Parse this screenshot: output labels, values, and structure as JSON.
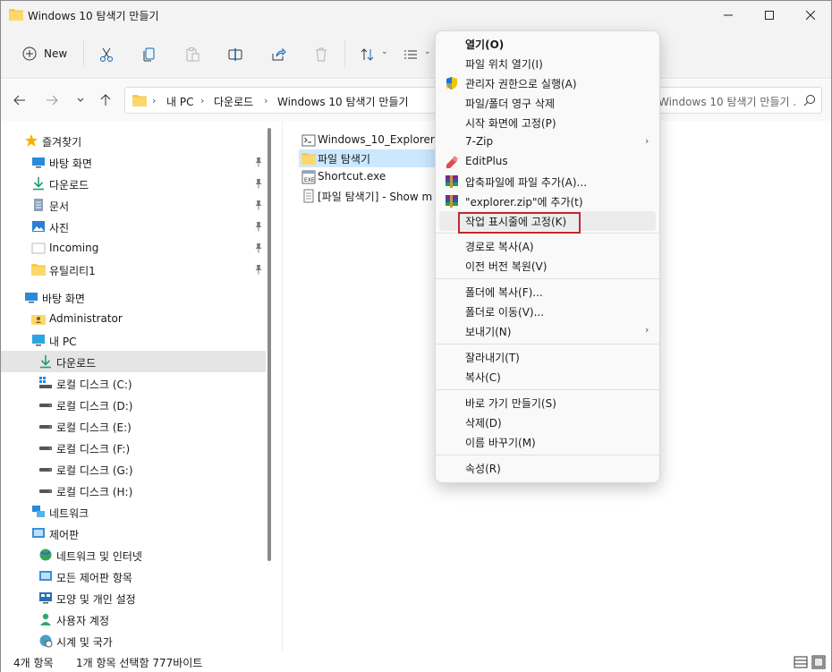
{
  "window": {
    "title": "Windows 10 탐색기 만들기"
  },
  "toolbar": {
    "new_label": "New"
  },
  "address": {
    "crumbs": [
      "내 PC",
      "다운로드",
      "Windows 10 탐색기 만들기"
    ],
    "search_placeholder": "Windows 10 탐색기 만들기 ..."
  },
  "nav": {
    "items": [
      {
        "label": "즐겨찾기",
        "icon": "star-icon"
      },
      {
        "label": "바탕 화면",
        "icon": "desktop-icon",
        "pinned": true
      },
      {
        "label": "다운로드",
        "icon": "download-icon",
        "pinned": true
      },
      {
        "label": "문서",
        "icon": "document-icon",
        "pinned": true
      },
      {
        "label": "사진",
        "icon": "pictures-icon",
        "pinned": true
      },
      {
        "label": "Incoming",
        "icon": "folder-white-icon",
        "pinned": true
      },
      {
        "label": "유틸리티1",
        "icon": "folder-icon",
        "pinned": true
      },
      {
        "label": "바탕 화면",
        "icon": "desktop-icon"
      },
      {
        "label": "Administrator",
        "icon": "user-folder-icon"
      },
      {
        "label": "내 PC",
        "icon": "pc-icon"
      },
      {
        "label": "다운로드",
        "icon": "download-icon",
        "selected": true
      },
      {
        "label": "로컬 디스크 (C:)",
        "icon": "system-drive-icon"
      },
      {
        "label": "로컬 디스크 (D:)",
        "icon": "drive-icon"
      },
      {
        "label": "로컬 디스크 (E:)",
        "icon": "drive-icon"
      },
      {
        "label": "로컬 디스크 (F:)",
        "icon": "drive-icon"
      },
      {
        "label": "로컬 디스크 (G:)",
        "icon": "drive-icon"
      },
      {
        "label": "로컬 디스크 (H:)",
        "icon": "drive-icon"
      },
      {
        "label": "네트워크",
        "icon": "network-icon"
      },
      {
        "label": "제어판",
        "icon": "control-panel-icon"
      },
      {
        "label": "네트워크 및 인터넷",
        "icon": "network-internet-icon"
      },
      {
        "label": "모든 제어판 항목",
        "icon": "control-panel-icon"
      },
      {
        "label": "모양 및 개인 설정",
        "icon": "personalization-icon"
      },
      {
        "label": "사용자 계정",
        "icon": "user-icon"
      },
      {
        "label": "시계 및 국가",
        "icon": "clock-region-icon"
      }
    ]
  },
  "files": [
    {
      "label": "Windows_10_Explorer.cm",
      "icon": "cmd-file-icon"
    },
    {
      "label": "파일 탐색기",
      "icon": "folder-icon",
      "selected": true
    },
    {
      "label": "Shortcut.exe",
      "icon": "exe-icon"
    },
    {
      "label": "[파일 탐색기] - Show m",
      "icon": "text-file-icon"
    }
  ],
  "context_menu": {
    "items": [
      {
        "label": "열기(O)",
        "bold": true
      },
      {
        "label": "파일 위치 열기(I)"
      },
      {
        "label": "관리자 권한으로 실행(A)",
        "icon": "shield-icon"
      },
      {
        "label": "파일/폴더 영구 삭제"
      },
      {
        "label": "시작 화면에 고정(P)"
      },
      {
        "label": "7-Zip",
        "submenu": true
      },
      {
        "label": "EditPlus",
        "icon": "editplus-icon"
      },
      {
        "label": "압축파일에 파일 추가(A)...",
        "icon": "winrar-icon"
      },
      {
        "label": "\"explorer.zip\"에 추가(t)",
        "icon": "winrar-icon"
      },
      {
        "label": "작업 표시줄에 고정(K)",
        "hover": true
      },
      {
        "label": "경로로 복사(A)"
      },
      {
        "label": "이전 버전 복원(V)"
      },
      {
        "label": "폴더에 복사(F)..."
      },
      {
        "label": "폴더로 이동(V)..."
      },
      {
        "label": "보내기(N)",
        "submenu": true
      },
      {
        "label": "잘라내기(T)"
      },
      {
        "label": "복사(C)"
      },
      {
        "label": "바로 가기 만들기(S)"
      },
      {
        "label": "삭제(D)"
      },
      {
        "label": "이름 바꾸기(M)"
      },
      {
        "label": "속성(R)"
      }
    ]
  },
  "status": {
    "count": "4개 항목",
    "selection": "1개 항목 선택함 777바이트"
  },
  "colors": {
    "accent": "#0067c0",
    "highlight_box": "#c0282d",
    "folder": "#f8c94b"
  }
}
